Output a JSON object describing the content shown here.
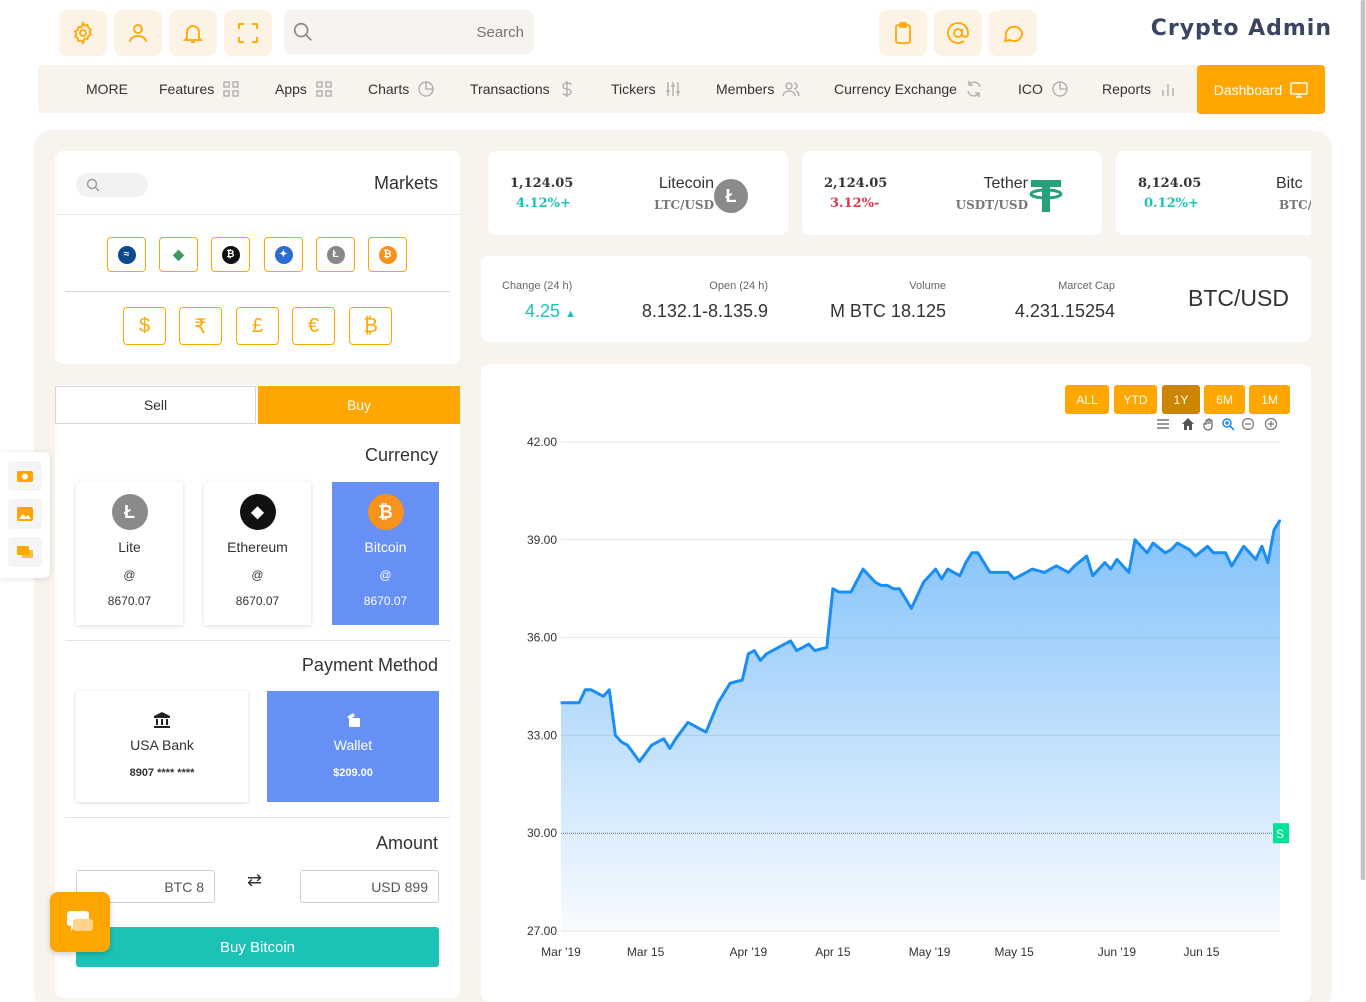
{
  "header": {
    "search_placeholder": "Search",
    "brand": "Crypto Admin",
    "icons_left": [
      "gear-icon",
      "user-icon",
      "bell-icon",
      "fullscreen-icon"
    ],
    "icons_right": [
      "clipboard-icon",
      "at-icon",
      "chat-icon"
    ],
    "accent": "#ffa600"
  },
  "nav": {
    "items": [
      {
        "label": "MORE",
        "icon": ""
      },
      {
        "label": "Features",
        "icon": "grid-icon"
      },
      {
        "label": "Apps",
        "icon": "grid-icon"
      },
      {
        "label": "Charts",
        "icon": "pie-icon"
      },
      {
        "label": "Transactions",
        "icon": "dollar-icon"
      },
      {
        "label": "Tickers",
        "icon": "sliders-icon"
      },
      {
        "label": "Members",
        "icon": "users-icon"
      },
      {
        "label": "Currency Exchange",
        "icon": "refresh-icon"
      },
      {
        "label": "ICO",
        "icon": "pie-icon"
      },
      {
        "label": "Reports",
        "icon": "bar-icon"
      }
    ],
    "dashboard": "Dashboard"
  },
  "markets": {
    "title": "Markets",
    "coins": [
      "waves-icon",
      "ethereum-icon",
      "bitcoin-black-icon",
      "ripple-icon",
      "litecoin-icon",
      "bitcoin-icon"
    ],
    "currencies": [
      "$",
      "₹",
      "£",
      "€",
      "₿"
    ]
  },
  "trade": {
    "tab_sell": "Sell",
    "tab_buy": "Buy",
    "currency_title": "Currency",
    "currencies": [
      {
        "name": "Lite",
        "at": "@",
        "value": "8670.07"
      },
      {
        "name": "Ethereum",
        "at": "@",
        "value": "8670.07"
      },
      {
        "name": "Bitcoin",
        "at": "@",
        "value": "8670.07"
      }
    ],
    "payment_title": "Payment Method",
    "payments": [
      {
        "name": "USA Bank",
        "value": "8907 **** ****"
      },
      {
        "name": "Wallet",
        "value": "$209.00"
      }
    ],
    "amount_title": "Amount",
    "amount_from": "BTC 8",
    "amount_to": "USD 899",
    "swap": "⇄",
    "buy_button": "Buy Bitcoin"
  },
  "tickers": [
    {
      "price": "1,124.05",
      "change": "4.12%+",
      "name": "Litecoin",
      "pair": "LTC/USD",
      "trend": "up"
    },
    {
      "price": "2,124.05",
      "change": "3.12%-",
      "name": "Tether",
      "pair": "USDT/USD",
      "trend": "down"
    },
    {
      "price": "8,124.05",
      "change": "0.12%+",
      "name": "Bitc",
      "pair": "BTC/",
      "trend": "up"
    }
  ],
  "stats": {
    "change_label": "Change (24 h)",
    "change_value": "4.25",
    "open_label": "Open (24 h)",
    "open_value": "8.132.1-8.135.9",
    "volume_label": "Volume",
    "volume_value": "M BTC 18.125",
    "cap_label": "Marcet Cap",
    "cap_value": "4.231.15254",
    "pair": "BTC/USD"
  },
  "chart_controls": {
    "ranges": [
      "ALL",
      "YTD",
      "1Y",
      "6M",
      "1M"
    ],
    "selected": "1Y",
    "tools": [
      "menu-icon",
      "home-icon",
      "pan-icon",
      "zoom-icon",
      "zoom-out-icon",
      "zoom-in-icon"
    ],
    "annotation_label": "S"
  },
  "chart_data": {
    "type": "area",
    "title": "",
    "xlabel": "",
    "ylabel": "",
    "ylim": [
      27,
      42
    ],
    "y_ticks": [
      "27.00",
      "30.00",
      "33.00",
      "36.00",
      "39.00",
      "42.00"
    ],
    "x_ticks": [
      "Mar '19",
      "Mar 15",
      "Apr '19",
      "Apr 15",
      "May '19",
      "May 15",
      "Jun '19",
      "Jun 15"
    ],
    "x_range": [
      "2019-03-01",
      "2019-06-28"
    ],
    "annotation_y": 30,
    "color": "#1a8ef5",
    "series": [
      {
        "x": [
          "2019-03-01",
          "2019-03-04",
          "2019-03-05",
          "2019-03-06",
          "2019-03-08",
          "2019-03-09",
          "2019-03-10",
          "2019-03-11",
          "2019-03-12",
          "2019-03-14",
          "2019-03-16",
          "2019-03-17",
          "2019-03-18",
          "2019-03-19",
          "2019-03-20",
          "2019-03-22",
          "2019-03-23",
          "2019-03-24",
          "2019-03-25",
          "2019-03-27",
          "2019-03-28",
          "2019-03-29",
          "2019-03-31",
          "2019-04-01",
          "2019-04-02",
          "2019-04-03",
          "2019-04-04",
          "2019-04-07",
          "2019-04-08",
          "2019-04-09",
          "2019-04-10",
          "2019-04-11",
          "2019-04-12",
          "2019-04-14",
          "2019-04-15",
          "2019-04-16",
          "2019-04-17",
          "2019-04-18",
          "2019-04-20",
          "2019-04-22",
          "2019-04-23",
          "2019-04-24",
          "2019-04-25",
          "2019-04-26",
          "2019-04-28",
          "2019-04-29",
          "2019-04-30",
          "2019-05-02",
          "2019-05-03",
          "2019-05-04",
          "2019-05-06",
          "2019-05-07",
          "2019-05-08",
          "2019-05-09",
          "2019-05-11",
          "2019-05-12",
          "2019-05-14",
          "2019-05-15",
          "2019-05-17",
          "2019-05-18",
          "2019-05-20",
          "2019-05-21",
          "2019-05-22",
          "2019-05-24",
          "2019-05-25",
          "2019-05-27",
          "2019-05-28",
          "2019-05-30",
          "2019-05-31",
          "2019-06-01",
          "2019-06-03",
          "2019-06-04",
          "2019-06-06",
          "2019-06-07",
          "2019-06-09",
          "2019-06-10",
          "2019-06-11",
          "2019-06-13",
          "2019-06-14",
          "2019-06-16",
          "2019-06-17",
          "2019-06-19",
          "2019-06-20",
          "2019-06-22",
          "2019-06-24",
          "2019-06-25",
          "2019-06-26",
          "2019-06-27",
          "2019-06-28"
        ],
        "values": [
          34.0,
          34.0,
          34.4,
          34.4,
          34.2,
          34.4,
          33.0,
          32.8,
          32.7,
          32.2,
          32.7,
          32.8,
          32.9,
          32.6,
          32.9,
          33.4,
          33.3,
          33.2,
          33.1,
          34.0,
          34.3,
          34.6,
          34.7,
          35.5,
          35.6,
          35.3,
          35.5,
          35.8,
          35.9,
          35.6,
          35.7,
          35.8,
          35.6,
          35.7,
          37.5,
          37.4,
          37.4,
          37.4,
          38.1,
          37.7,
          37.6,
          37.6,
          37.5,
          37.5,
          36.9,
          37.3,
          37.7,
          38.1,
          37.8,
          38.1,
          37.9,
          38.3,
          38.6,
          38.6,
          38.0,
          38.0,
          38.0,
          37.8,
          38.0,
          38.1,
          38.0,
          38.1,
          38.2,
          38.0,
          38.2,
          38.5,
          37.9,
          38.3,
          38.1,
          38.4,
          38.0,
          39.0,
          38.6,
          38.9,
          38.6,
          38.7,
          38.9,
          38.7,
          38.5,
          38.8,
          38.6,
          38.6,
          38.2,
          38.8,
          38.4,
          38.8,
          38.3,
          39.3,
          39.6
        ]
      }
    ]
  }
}
